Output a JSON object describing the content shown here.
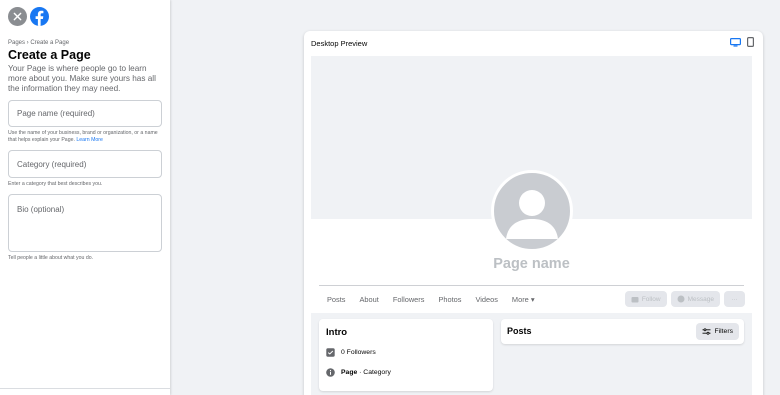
{
  "sidebar": {
    "breadcrumb": "Pages › Create a Page",
    "title": "Create a Page",
    "description": "Your Page is where people go to learn more about you. Make sure yours has all the information they may need.",
    "page_name_placeholder": "Page name (required)",
    "page_name_hint": "Use the name of your business, brand or organization, or a name that helps explain your Page.",
    "learn_more": "Learn More",
    "category_placeholder": "Category (required)",
    "category_hint": "Enter a category that best describes you.",
    "bio_placeholder": "Bio (optional)",
    "bio_hint": "Tell people a little about what you do."
  },
  "preview": {
    "title": "Desktop Preview",
    "page_name": "Page name",
    "tabs": [
      "Posts",
      "About",
      "Followers",
      "Photos",
      "Videos",
      "More ▾"
    ],
    "follow_label": "Follow",
    "message_label": "Message",
    "more_label": "···",
    "intro_title": "Intro",
    "followers_text": "0 Followers",
    "page_label": "Page",
    "category_text": " · Category",
    "posts_title": "Posts",
    "filters_label": "Filters"
  },
  "colors": {
    "brand": "#1877f2",
    "background": "#f0f2f5",
    "muted": "#65676b"
  }
}
